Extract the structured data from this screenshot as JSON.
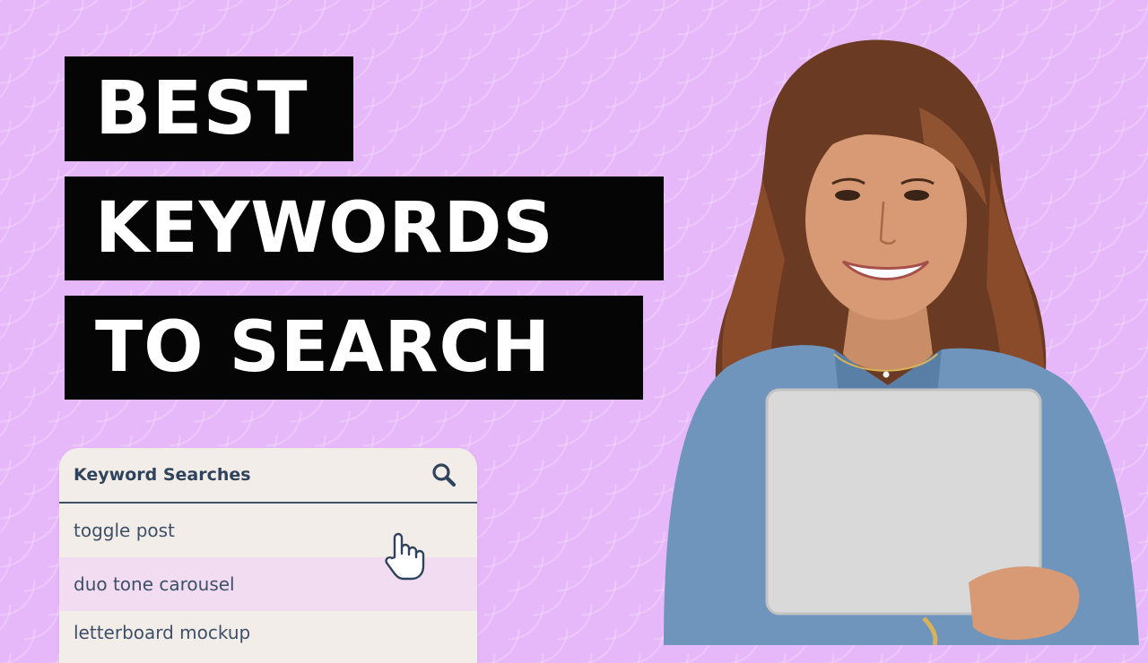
{
  "headline": {
    "line1": "BEST",
    "line2": "KEYWORDS",
    "line3": "TO SEARCH"
  },
  "search_panel": {
    "title": "Keyword Searches",
    "items": [
      {
        "label": "toggle post"
      },
      {
        "label": "duo tone carousel"
      },
      {
        "label": "letterboard mockup"
      }
    ]
  },
  "colors": {
    "background": "#e7b8f9",
    "title_bar": "#050505",
    "title_text": "#ffffff",
    "panel": "#f3ede9",
    "panel_highlight": "#f2dcf2",
    "panel_text": "#2f445c"
  },
  "icons": {
    "search": "search-icon",
    "cursor": "pointer-hand-icon"
  }
}
